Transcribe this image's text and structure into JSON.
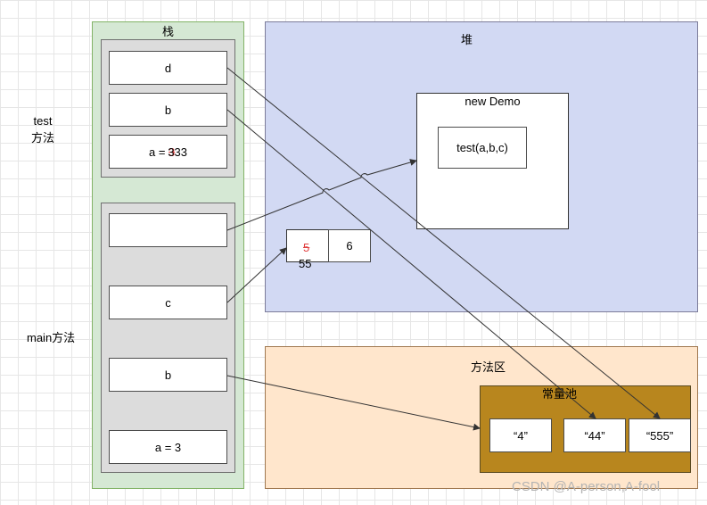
{
  "stack": {
    "title": "栈",
    "test_label_line1": "test",
    "test_label_line2": "方法",
    "main_label": "main方法",
    "test_frame": {
      "d": "d",
      "b": "b",
      "a_prefix": "a = ",
      "a_struck": "3",
      "a_value": "333"
    },
    "main_frame": {
      "ref": "",
      "c": "c",
      "b": "b",
      "a": "a = 3"
    }
  },
  "heap": {
    "title": "堆",
    "object_title": "new Demo",
    "method_box": "test(a,b,c)",
    "array": {
      "cell0_struck": "5",
      "cell0_value": "55",
      "cell1": "6"
    }
  },
  "method_area": {
    "title": "方法区",
    "pool_title": "常量池",
    "constants": [
      "“4”",
      "“44”",
      "“555”"
    ]
  },
  "watermark": "CSDN @A-person,A-fool",
  "colors": {
    "stack_bg": "#d5e8d4",
    "heap_bg": "#d2d9f3",
    "method_area_bg": "#ffe6cc",
    "pool_bg": "#b8861e"
  }
}
